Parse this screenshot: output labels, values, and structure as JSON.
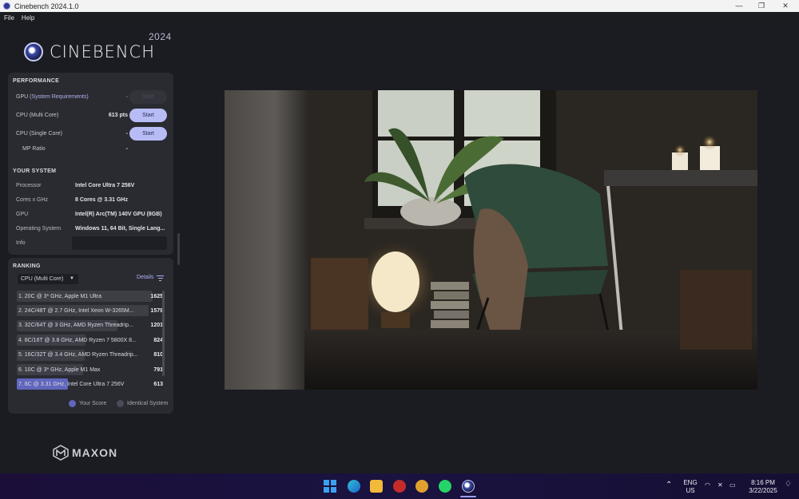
{
  "window": {
    "title": "Cinebench 2024.1.0",
    "controls": [
      "—",
      "❐",
      "✕"
    ]
  },
  "menu": {
    "file": "File",
    "help": "Help"
  },
  "logo": {
    "wordmark": "CINEBENCH",
    "year": "2024"
  },
  "performance": {
    "title": "PERFORMANCE",
    "gpu_prefix": "GPU",
    "gpu_req": "(System Requirements)",
    "gpu_value": "-",
    "gpu_button": "Start",
    "multi_label": "CPU (Multi Core)",
    "multi_value": "613 pts",
    "multi_button": "Start",
    "single_label": "CPU (Single Core)",
    "single_value": "-",
    "single_button": "Start",
    "mp_label": "MP Ratio",
    "mp_value": "-"
  },
  "system": {
    "title": "YOUR SYSTEM",
    "rows": [
      {
        "key": "Processor",
        "value": "Intel Core Ultra 7 256V"
      },
      {
        "key": "Cores x GHz",
        "value": "8 Cores @ 3.31 GHz"
      },
      {
        "key": "GPU",
        "value": "Intel(R) Arc(TM) 140V GPU (8GB)"
      },
      {
        "key": "Operating System",
        "value": "Windows 11, 64 Bit, Single Lang..."
      },
      {
        "key": "Info",
        "value": ""
      }
    ]
  },
  "ranking": {
    "title": "RANKING",
    "select": "CPU (Multi Core)",
    "details": "Details",
    "rows": [
      {
        "name": "1. 20C @ 3* GHz, Apple M1 Ultra",
        "score": "1625",
        "ratio": 1.0,
        "mine": false
      },
      {
        "name": "2. 24C/48T @ 2.7 GHz, Intel Xeon W-3265M...",
        "score": "1579",
        "ratio": 0.972,
        "mine": false
      },
      {
        "name": "3. 32C/64T @ 3 GHz, AMD Ryzen Threadrip...",
        "score": "1201",
        "ratio": 0.739,
        "mine": false
      },
      {
        "name": "4. 8C/16T @ 3.8 GHz, AMD Ryzen 7 5800X 8...",
        "score": "824",
        "ratio": 0.507,
        "mine": false
      },
      {
        "name": "5. 16C/32T @ 3.4 GHz, AMD Ryzen Threadrip...",
        "score": "810",
        "ratio": 0.498,
        "mine": false
      },
      {
        "name": "6. 10C @ 3* GHz, Apple M1 Max",
        "score": "791",
        "ratio": 0.487,
        "mine": false
      },
      {
        "name": "7. 8C @ 3.31 GHz, Intel Core Ultra 7 256V",
        "score": "613",
        "ratio": 0.377,
        "mine": true
      }
    ],
    "legend_yours": "Your Score",
    "legend_identical": "Identical System",
    "color_yours": "#6166bd",
    "color_identical": "#3d3e46"
  },
  "brand": {
    "maxon": "MAXON"
  },
  "taskbar": {
    "lang1": "ENG",
    "lang2": "US",
    "time": "8:16 PM",
    "date": "3/22/2025",
    "chevron": "⌃",
    "apps": [
      "windows-start",
      "edge",
      "file-explorer",
      "solidworks",
      "winbench",
      "whatsapp",
      "cinebench"
    ]
  }
}
